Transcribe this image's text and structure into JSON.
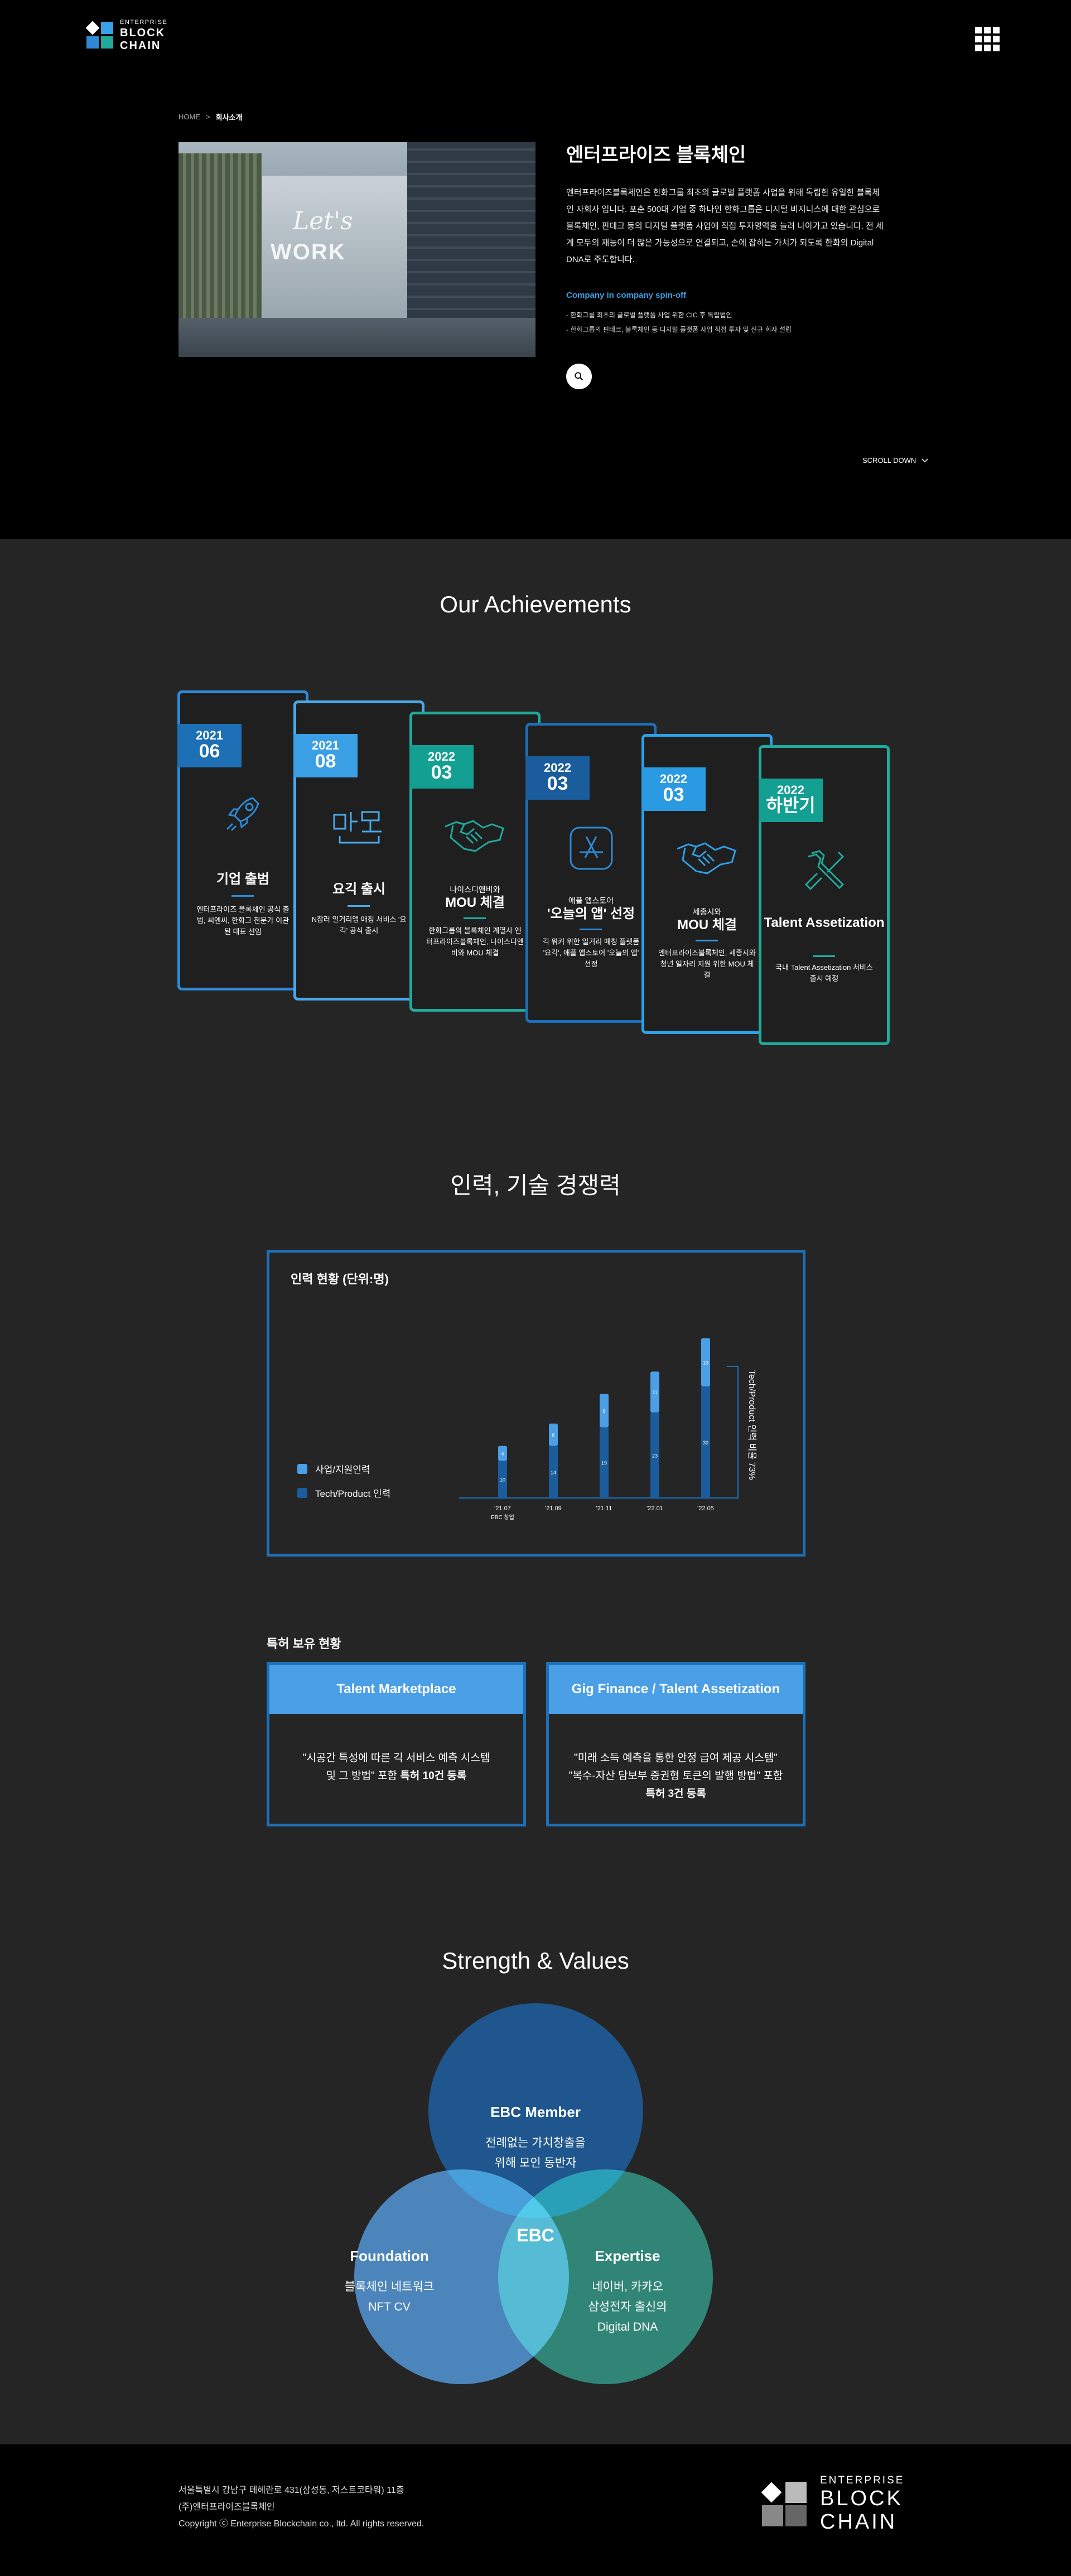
{
  "header": {
    "logo_small": "ENTERPRISE",
    "logo_line1": "BLOCK",
    "logo_line2": "CHAIN",
    "menu_icon": "grid-menu-icon"
  },
  "breadcrumb": {
    "home": "HOME",
    "separator": ">",
    "current": "회사소개"
  },
  "hero": {
    "title": "엔터프라이즈 블록체인",
    "description": "엔터프라이즈블록체인은 한화그룹 최초의 글로벌 플랫폼 사업을 위해 독립한 유일한 블록체인 자회사 입니다. 포춘 500대 기업 중 하나인 한화그룹은 디지털 비지니스에 대한 관심으로 블록체인, 핀테크 등의 디지털 플랫폼 사업에 직접 투자영역을 늘려 나아가고 있습니다. 전 세계 모두의 재능이 더 많은 가능성으로 연결되고, 손에 잡히는 가치가 되도록 한화의 Digital DNA로 주도합니다.",
    "subheading": "Company in company spin-off",
    "bullets": [
      "- 한화그룹 최초의 글로벌 플랫폼 사업 위한 CIC 후 독립법인",
      "- 한화그룹의 핀테크, 블록체인 등 디지털 플랫폼 사업 직접 투자 및 신규 회사 설립"
    ],
    "photo_sign_1": "Let's",
    "photo_sign_2": "WORK",
    "scroll_down": "SCROLL DOWN"
  },
  "achievements": {
    "title": "Our Achievements",
    "cards": [
      {
        "year": "2021",
        "month": "06",
        "pre": "",
        "title": "기업 출범",
        "desc": "엔터프라이즈 블록체인 공식 출범, 씨엔씨, 한화그 전문가 이관된 대표 선임",
        "icon": "rocket-icon",
        "color": "#2e8ad6",
        "badge": "#1d6fb6",
        "underline": "#2e8ad6"
      },
      {
        "year": "2021",
        "month": "08",
        "pre": "",
        "title": "요긱 출시",
        "desc": "N잡러 일거리앱 매칭 서비스 '요긱' 공식 출시",
        "icon": "yogig-icon",
        "color": "#4aa8e8",
        "badge": "#3b9fe6",
        "underline": "#4aa8e8"
      },
      {
        "year": "2022",
        "month": "03",
        "pre": "나이스디앤비와",
        "title": "MOU 체결",
        "desc": "한화그룹의 블록체인 계열사 엔터프라이즈블록체인, 나이스디앤비와 MOU 체결",
        "icon": "handshake-icon",
        "color": "#1faa9c",
        "badge": "#13a093",
        "underline": "#1faa9c"
      },
      {
        "year": "2022",
        "month": "03",
        "pre": "애플 앱스토어",
        "title": "'오늘의 앱' 선정",
        "desc": "긱 워커 위한 일거리 매칭 플랫폼 '요긱', 애플 앱스토어 '오늘의 앱' 선정",
        "icon": "appstore-icon",
        "color": "#1d6fb6",
        "badge": "#1a5c9c",
        "underline": "#2e8ad6"
      },
      {
        "year": "2022",
        "month": "03",
        "pre": "세종시와",
        "title": "MOU 체결",
        "desc": "엔터프라이즈블록체인, 세종시와 청년 일자리 지원 위한 MOU 체결",
        "icon": "handshake-icon",
        "color": "#2ea0e6",
        "badge": "#2a9be2",
        "underline": "#2ea0e6"
      },
      {
        "year": "2022",
        "month": "하반기",
        "pre": "",
        "title": "Talent Assetization",
        "desc": "국내 Talent Assetization 서비스 출시 예정",
        "icon": "tools-icon",
        "color": "#1faa9c",
        "badge": "#13a093",
        "underline": "#1faa9c"
      }
    ]
  },
  "competency": {
    "title": "인력, 기술 경쟁력",
    "chart_title": "인력 현황 (단위:명)",
    "side_label": "Tech/Product 인력 비율 73%",
    "chart_data": {
      "type": "bar",
      "stacked": true,
      "categories": [
        "'21.07",
        "'21.09",
        "'21.11",
        "'22.01",
        "'22.05"
      ],
      "category_note": "EBC 창업",
      "series": [
        {
          "name": "사업/지원인력",
          "color": "#4a9fe6",
          "values": [
            4,
            6,
            9,
            11,
            13
          ]
        },
        {
          "name": "Tech/Product 인력",
          "color": "#1a5c9c",
          "values": [
            10,
            14,
            19,
            23,
            30
          ]
        }
      ]
    }
  },
  "patents": {
    "title": "특허 보유 현황",
    "items": [
      {
        "header": "Talent Marketplace",
        "line1": "\"시공간 특성에 따른 긱 서비스 예측 시스템",
        "line2": "및 그 방법\" 포함 ",
        "bold": "특허 10건 등록"
      },
      {
        "header": "Gig Finance / Talent Assetization",
        "line1": "\"미래 소득 예측을 통한 안정 급여 제공 시스템\"",
        "line2": "\"복수-자산 담보부 증권형 토큰의 발행 방법\" 포함",
        "bold": "특허 3건 등록"
      }
    ]
  },
  "strength": {
    "title": "Strength & Values",
    "center": "EBC",
    "circles": [
      {
        "title": "EBC Member",
        "line1": "전례없는 가치창출을",
        "line2": "위해 모인 동반자"
      },
      {
        "title": "Foundation",
        "line1": "블록체인 네트워크",
        "line2": "NFT CV"
      },
      {
        "title": "Expertise",
        "line1": "네이버, 카카오",
        "line2": "삼성전자 출신의",
        "line3": "Digital DNA"
      }
    ]
  },
  "footer": {
    "address": "서울특별시 강남구 테헤란로 431(삼성동, 저스트코타워) 11층",
    "company": "(주)엔터프라이즈블록체인",
    "copyright": "Copyright ⓒ Enterprise Blockchain co., ltd. All rights reserved.",
    "logo_small": "ENTERPRISE",
    "logo_line1": "BLOCK",
    "logo_line2": "CHAIN"
  }
}
